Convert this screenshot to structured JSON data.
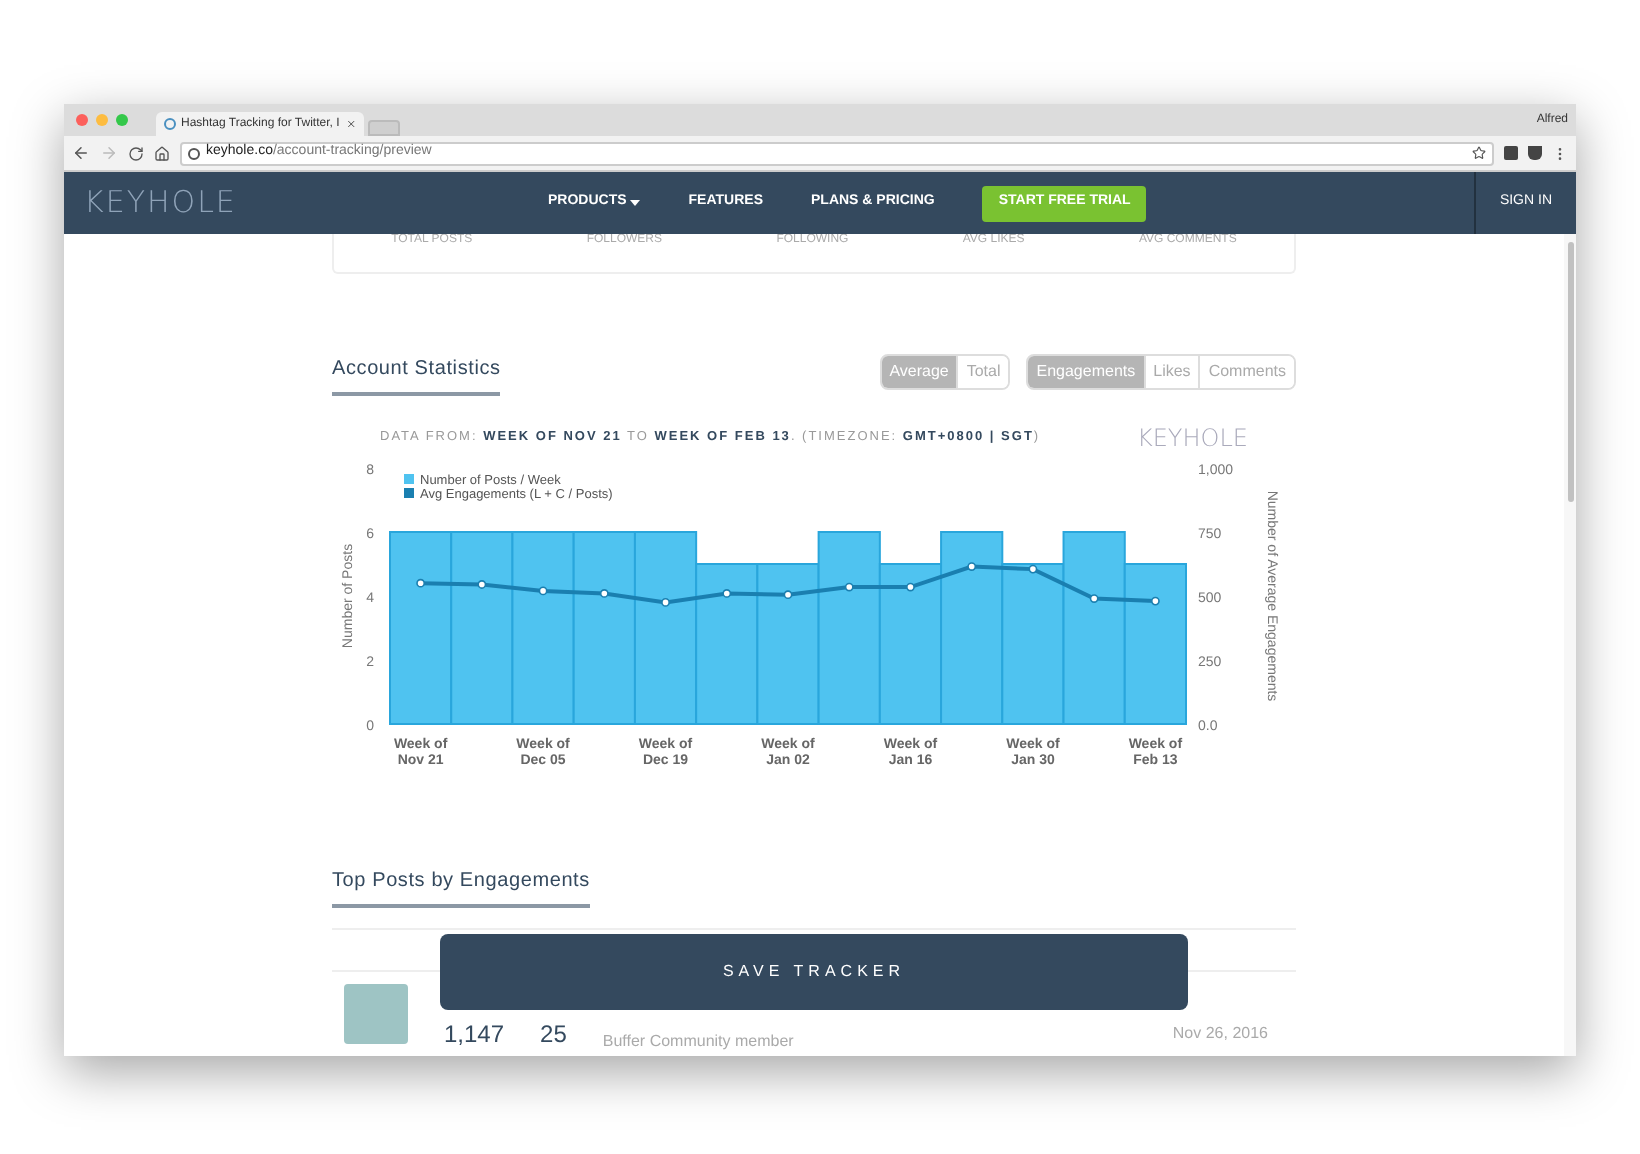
{
  "browser": {
    "tab_title": "Hashtag Tracking for Twitter, I",
    "user": "Alfred",
    "url_host": "keyhole.co",
    "url_path": "/account-tracking/preview"
  },
  "navbar": {
    "logo": "KEYHOLE",
    "items": [
      {
        "label": "PRODUCTS",
        "kind": "dropdown"
      },
      {
        "label": "FEATURES",
        "kind": "link"
      },
      {
        "label": "PLANS & PRICING",
        "kind": "link"
      }
    ],
    "cta": "START FREE TRIAL",
    "sign_in": "SIGN IN"
  },
  "stats_headers": [
    "TOTAL POSTS",
    "FOLLOWERS",
    "FOLLOWING",
    "AVG LIKES",
    "AVG COMMENTS"
  ],
  "account_statistics": {
    "title": "Account Statistics",
    "mode_toggle": [
      {
        "label": "Average",
        "selected": true
      },
      {
        "label": "Total",
        "selected": false
      }
    ],
    "metric_toggle": [
      {
        "label": "Engagements",
        "selected": true
      },
      {
        "label": "Likes",
        "selected": false
      },
      {
        "label": "Comments",
        "selected": false
      }
    ],
    "data_from": "DATA FROM: **WEEK OF NOV 21** TO **WEEK OF FEB 13**. (TIMEZONE: **GMT+0800 | SGT**)",
    "watermark_logo": "KEYHOLE",
    "chart_data": {
      "type": "bar",
      "ylabel": "Number of Posts",
      "categories": [
        "Week of Nov 21",
        null,
        "Week of Dec 05",
        null,
        "Week of Dec 19",
        null,
        "Week of Jan 02",
        null,
        "Week of Jan 16",
        null,
        "Week of Jan 30",
        null,
        "Week of Feb 13"
      ],
      "series": [
        {
          "name": "Number of Posts / Week",
          "color": "#4fc3f0",
          "values": [
            6,
            6,
            6,
            6,
            6,
            5,
            5,
            6,
            5,
            6,
            5,
            6,
            5
          ]
        }
      ],
      "ylim": [
        0,
        8
      ],
      "yticks": [
        {
          "value": 0,
          "label": "0"
        },
        {
          "value": 2,
          "label": "2"
        },
        {
          "value": 4,
          "label": "4"
        },
        {
          "value": 6,
          "label": "6"
        },
        {
          "value": 8,
          "label": "8"
        }
      ]
    },
    "line_overlay": {
      "chart_data": {
        "type": "line",
        "ylabel": "Number of Average Engagements",
        "categories": [
          null,
          null,
          null,
          null,
          null,
          null,
          null,
          null,
          null,
          null,
          null,
          null,
          null
        ],
        "series": [
          {
            "name": "Avg Engagements (L + C / Posts)",
            "color": "#1a7fb0",
            "marker": true,
            "values": [
              550,
              545,
              520,
              510,
              475,
              510,
              505,
              535,
              535,
              615,
              605,
              490,
              480
            ]
          }
        ],
        "ylim": [
          0,
          1000
        ],
        "yticks": [
          {
            "value": 0,
            "label": "0.0"
          },
          {
            "value": 250,
            "label": "250"
          },
          {
            "value": 500,
            "label": "500"
          },
          {
            "value": 750,
            "label": "750"
          },
          {
            "value": 1000,
            "label": "1,000"
          }
        ]
      }
    }
  },
  "top_posts": {
    "title": "Top Posts by Engagements",
    "rows": [
      {
        "engagements": "1,147",
        "column_2": "25",
        "author": "Buffer Community member",
        "date": "Nov 26, 2016"
      }
    ]
  },
  "save_button": "SAVE TRACKER"
}
